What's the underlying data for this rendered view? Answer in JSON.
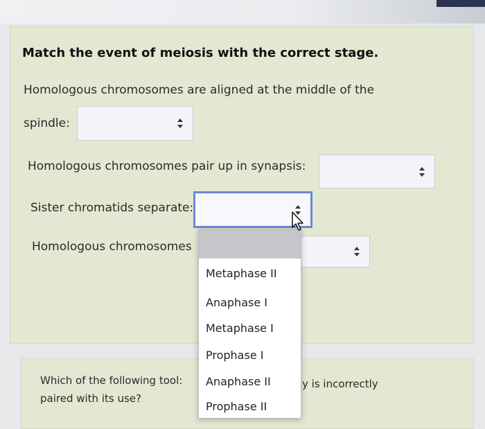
{
  "heading": "Match the event of meiosis with the correct stage.",
  "q1": {
    "line1": "Homologous chromosomes are aligned at the middle of the",
    "line2": "spindle:",
    "selected": ""
  },
  "q2": {
    "text": "Homologous chromosomes pair up in synapsis:",
    "selected": ""
  },
  "q3": {
    "text": "Sister chromatids separate:",
    "selected": ""
  },
  "q4": {
    "text": "Homologous chromosomes",
    "selected": ""
  },
  "dropdown": {
    "options": [
      "Metaphase II",
      "Anaphase I",
      "Metaphase I",
      "Prophase I",
      "Anaphase II",
      "Prophase II"
    ]
  },
  "next_question": {
    "line1_start": "Which of the following tool:",
    "line1_end": "y is incorrectly",
    "line2": "paired with its use?"
  },
  "colors": {
    "panel": "#e3e8d2",
    "focus_border": "#6f86d8"
  },
  "icons": [
    "select-arrows-icon",
    "mouse-pointer-icon"
  ]
}
